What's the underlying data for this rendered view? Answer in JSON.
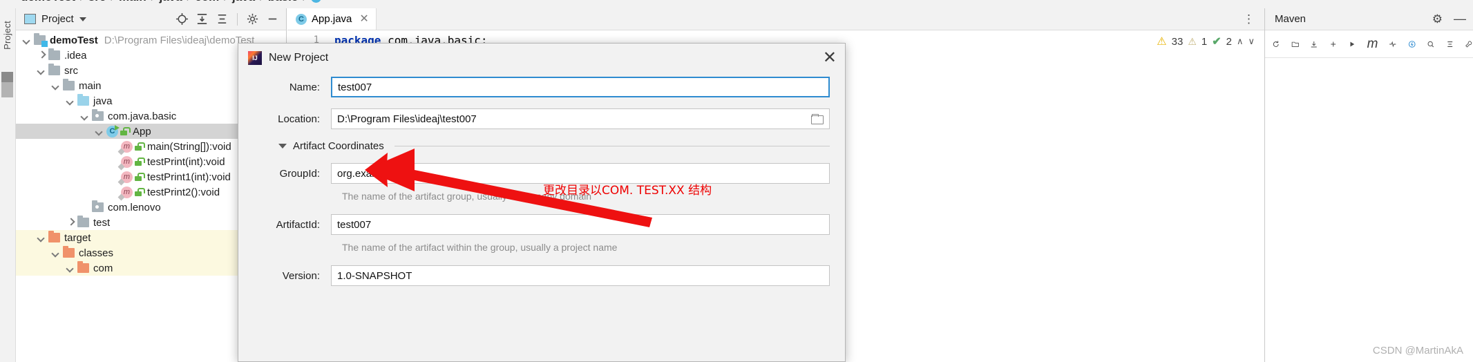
{
  "breadcrumb": {
    "items": [
      "demoTest",
      "src",
      "main",
      "java",
      "com",
      "java",
      "basic"
    ],
    "separator": "/",
    "trailing_icon": "class-icon"
  },
  "left_rail": {
    "label": "Project"
  },
  "project_panel": {
    "title": "Project",
    "caret": "chevron-down-icon",
    "toolbar_icons": [
      "locate-icon",
      "expand-all-icon",
      "collapse-all-icon",
      "gear-icon",
      "hide-icon"
    ],
    "tree": [
      {
        "indent": 0,
        "arrow": "down",
        "icon": "module-folder",
        "label": "demoTest",
        "bold": true,
        "path": "D:\\Program Files\\ideaj\\demoTest",
        "row_style": "normal"
      },
      {
        "indent": 1,
        "arrow": "right",
        "icon": "folder",
        "label": ".idea",
        "bold": false,
        "path": "",
        "row_style": "normal"
      },
      {
        "indent": 1,
        "arrow": "down",
        "icon": "folder",
        "label": "src",
        "bold": false,
        "path": "",
        "row_style": "normal"
      },
      {
        "indent": 2,
        "arrow": "down",
        "icon": "folder",
        "label": "main",
        "bold": false,
        "path": "",
        "row_style": "normal"
      },
      {
        "indent": 3,
        "arrow": "down",
        "icon": "folder-blue",
        "label": "java",
        "bold": false,
        "path": "",
        "row_style": "normal"
      },
      {
        "indent": 4,
        "arrow": "down",
        "icon": "package",
        "label": "com.java.basic",
        "bold": false,
        "path": "",
        "row_style": "normal"
      },
      {
        "indent": 5,
        "arrow": "down",
        "icon": "class",
        "label": "App",
        "bold": false,
        "path": "",
        "row_style": "selected"
      },
      {
        "indent": 6,
        "arrow": "none",
        "icon": "method",
        "label": "main(String[]):void",
        "bold": false,
        "path": "",
        "row_style": "normal"
      },
      {
        "indent": 6,
        "arrow": "none",
        "icon": "method",
        "label": "testPrint(int):void",
        "bold": false,
        "path": "",
        "row_style": "normal"
      },
      {
        "indent": 6,
        "arrow": "none",
        "icon": "method",
        "label": "testPrint1(int):void",
        "bold": false,
        "path": "",
        "row_style": "normal"
      },
      {
        "indent": 6,
        "arrow": "none",
        "icon": "method",
        "label": "testPrint2():void",
        "bold": false,
        "path": "",
        "row_style": "normal"
      },
      {
        "indent": 4,
        "arrow": "none",
        "icon": "package",
        "label": "com.lenovo",
        "bold": false,
        "path": "",
        "row_style": "normal"
      },
      {
        "indent": 3,
        "arrow": "right",
        "icon": "folder",
        "label": "test",
        "bold": false,
        "path": "",
        "row_style": "normal"
      },
      {
        "indent": 1,
        "arrow": "down",
        "icon": "folder-orange",
        "label": "target",
        "bold": false,
        "path": "",
        "row_style": "tinted"
      },
      {
        "indent": 2,
        "arrow": "down",
        "icon": "folder-orange",
        "label": "classes",
        "bold": false,
        "path": "",
        "row_style": "tinted"
      },
      {
        "indent": 3,
        "arrow": "down",
        "icon": "folder-orange",
        "label": "com",
        "bold": false,
        "path": "",
        "row_style": "tinted"
      }
    ]
  },
  "editor": {
    "tab": {
      "label": "App.java",
      "icon": "java-class-icon",
      "close": "✕"
    },
    "kebab": "⋮",
    "line_number": "1",
    "code_keyword": "package",
    "code_rest": " com.java.basic;",
    "inspections": {
      "warning_icon": "⚠",
      "warning_count": "33",
      "weak_icon": "⚠",
      "weak_count": "1",
      "check_icon": "✔",
      "check_count": "2",
      "up_icon": "∧",
      "down_icon": "∨"
    }
  },
  "maven": {
    "title": "Maven",
    "gear_icon": "⚙",
    "minimize_icon": "—",
    "toolbar_icons": [
      "refresh-icon",
      "add-maven-project-icon",
      "download-sources-icon",
      "add-icon",
      "run-icon",
      "maven-m-icon",
      "toggle-skip-tests-icon",
      "execute-goal-icon",
      "search-icon",
      "collapse-all-icon",
      "settings-wrench-icon"
    ]
  },
  "dialog": {
    "icon": "intellij-idea-icon",
    "title": "New Project",
    "close_label": "✕",
    "fields": [
      {
        "label": "Name:",
        "value": "test007",
        "focused": true,
        "browse": false
      },
      {
        "label": "Location:",
        "value": "D:\\Program Files\\ideaj\\test007",
        "focused": false,
        "browse": true
      }
    ],
    "section": {
      "label": "Artifact Coordinates",
      "expanded": true
    },
    "coordinates": [
      {
        "label": "GroupId:",
        "value": "org.example",
        "hint": "The name of the artifact group, usually a company domain"
      },
      {
        "label": "ArtifactId:",
        "value": "test007",
        "hint": "The name of the artifact within the group, usually a project name"
      },
      {
        "label": "Version:",
        "value": "1.0-SNAPSHOT",
        "hint": ""
      }
    ]
  },
  "annotation": {
    "text": "更改目录以COM. TEST.XX 结构",
    "color": "#ee0000",
    "arrow": "red-arrow-pointing-to-groupid"
  },
  "watermark": {
    "text": "CSDN @MartinAkA"
  }
}
